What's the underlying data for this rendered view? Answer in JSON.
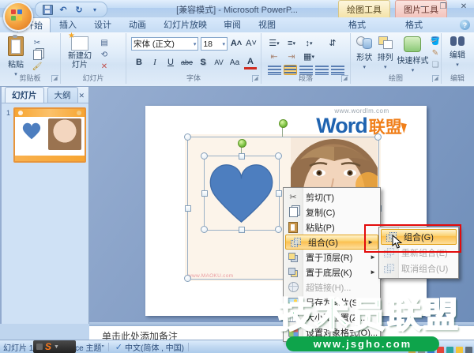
{
  "window": {
    "title": "[兼容模式] - Microsoft PowerP...",
    "drawing_tools": "绘图工具",
    "picture_tools": "图片工具",
    "minimize": "–",
    "restore": "❐",
    "close": "✕",
    "help": "?"
  },
  "tabs": {
    "items": [
      "开始",
      "插入",
      "设计",
      "动画",
      "幻灯片放映",
      "审阅",
      "视图",
      "格式",
      "格式"
    ],
    "active": "开始"
  },
  "ribbon": {
    "clipboard": {
      "label": "剪贴板",
      "paste": "粘贴"
    },
    "slides": {
      "label": "幻灯片",
      "new_slide": "新建幻灯片"
    },
    "font": {
      "label": "字体",
      "name": "宋体 (正文)",
      "size": "18",
      "bold": "B",
      "italic": "I",
      "underline": "U",
      "strike": "abe",
      "shadow": "S",
      "char_spacing": "AV",
      "change_case": "Aa",
      "font_color": "A"
    },
    "paragraph": {
      "label": "段落"
    },
    "drawing": {
      "label": "绘图",
      "shapes": "形状",
      "arrange": "排列",
      "quick_styles": "快速样式"
    },
    "editing": {
      "label": "编辑",
      "edit": "编辑"
    }
  },
  "panel": {
    "slides_tab": "幻灯片",
    "outline_tab": "大纲",
    "close": "✕",
    "slide_number": "1"
  },
  "slide": {
    "logo_url": "www.wordlm.com",
    "logo_word": "Word",
    "logo_cn": "联盟",
    "photo_mark": "www.MAOKU.com"
  },
  "menu": {
    "items": [
      {
        "label": "剪切(T)"
      },
      {
        "label": "复制(C)"
      },
      {
        "label": "粘贴(P)"
      },
      {
        "label": "组合(G)"
      },
      {
        "label": "置于顶层(R)"
      },
      {
        "label": "置于底层(K)"
      },
      {
        "label": "超链接(H)..."
      },
      {
        "label": "另存为图片(S)..."
      },
      {
        "label": "大小和位置(Z)..."
      },
      {
        "label": "设置对象格式(O)..."
      }
    ]
  },
  "submenu": {
    "items": [
      {
        "label": "组合(G)"
      },
      {
        "label": "重新组合(E)"
      },
      {
        "label": "取消组合(U)"
      }
    ]
  },
  "notes": {
    "placeholder": "单击此处添加备注"
  },
  "status": {
    "slide_label": "幻灯片 1/",
    "theme": "ce 主题”",
    "language": "中文(简体 , 中国)",
    "ime": "S"
  },
  "watermark": {
    "title": "技术员联盟",
    "url": "www.jsgho.com"
  },
  "colors": {
    "heart": "#4d7ebf",
    "watermark_green": "#0ea44b",
    "annotation_red": "#e30b0b",
    "highlight_orange": "#fbd06b"
  }
}
